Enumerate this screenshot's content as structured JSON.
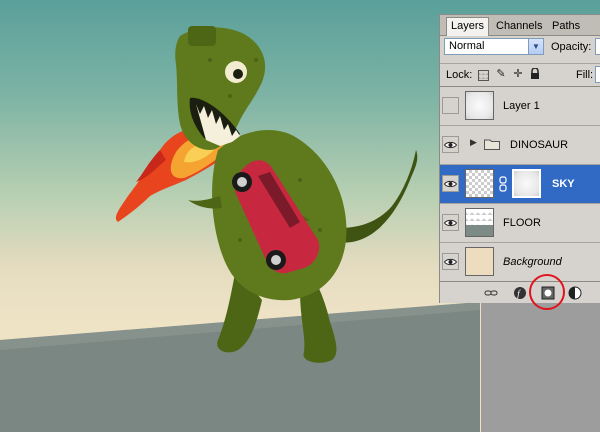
{
  "panel": {
    "tabs": [
      {
        "label": "Layers",
        "active": true
      },
      {
        "label": "Channels",
        "active": false
      },
      {
        "label": "Paths",
        "active": false
      }
    ],
    "blend_mode": "Normal",
    "opacity_label": "Opacity:",
    "lock_label": "Lock:",
    "fill_label": "Fill:",
    "layers": [
      {
        "name": "Layer 1",
        "visible": false,
        "thumbnail": "white",
        "selected": false
      },
      {
        "name": "DINOSAUR",
        "visible": true,
        "thumbnail": "folder",
        "selected": false,
        "collapsed": true
      },
      {
        "name": "SKY",
        "visible": true,
        "thumbnail": "sky",
        "has_mask": true,
        "selected": true
      },
      {
        "name": "FLOOR",
        "visible": true,
        "thumbnail": "floor",
        "selected": false
      },
      {
        "name": "Background",
        "visible": true,
        "thumbnail": "background",
        "selected": false,
        "italic": true
      }
    ],
    "footer_icons": [
      "link-layers-icon",
      "layer-style-icon",
      "add-layer-mask-icon",
      "adjustment-layer-icon"
    ]
  },
  "colors": {
    "selection": "#316ac5",
    "highlight_circle": "#e0141c",
    "dinosaur": "#5f7a1c",
    "car": "#c8283f",
    "flame": "#e8451e"
  }
}
